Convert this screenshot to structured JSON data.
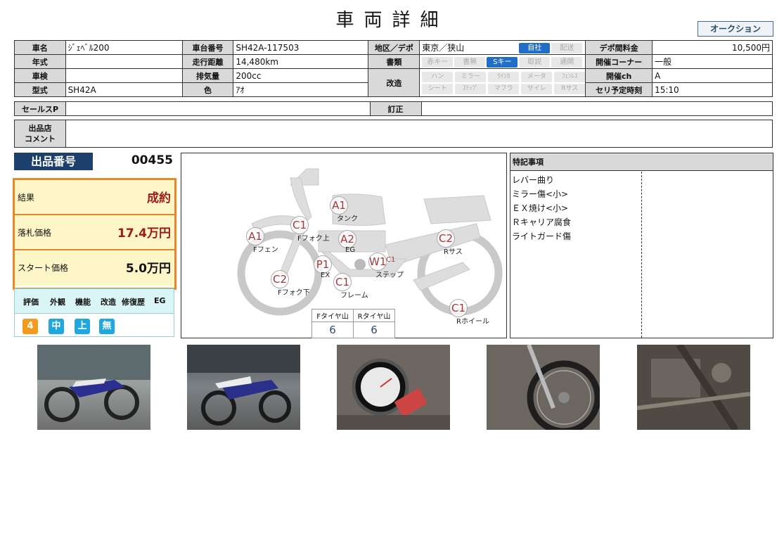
{
  "title": "車両詳細",
  "auction_button": "オークション",
  "info": {
    "row1": {
      "l1": "車名",
      "v1": "ｼﾞｪﾍﾞﾙ200",
      "l2": "車台番号",
      "v2": "SH42A-117503",
      "l3": "地区／デポ",
      "v3": "東京／狭山",
      "l4": "デポ間料金",
      "v4": "10,500円"
    },
    "row2": {
      "l1": "年式",
      "v1": "",
      "l2": "走行距離",
      "v2": "14,480km",
      "l3": "書類",
      "l4": "開催コーナー",
      "v4": "一般"
    },
    "row3": {
      "l1": "車検",
      "v1": "",
      "l2": "排気量",
      "v2": "200cc",
      "l3": "改造",
      "l4": "開催ch",
      "v4": "A"
    },
    "row4": {
      "l1": "型式",
      "v1": "SH42A",
      "l2": "色",
      "v2": "ｱｵ",
      "l4": "セリ予定時刻",
      "v4": "15:10"
    },
    "delivery": [
      {
        "label": "自社",
        "on": true
      },
      {
        "label": "配送",
        "on": false
      }
    ],
    "docs": [
      {
        "label": "赤キー",
        "on": false
      },
      {
        "label": "書無",
        "on": false
      },
      {
        "label": "Sキー",
        "on": true
      },
      {
        "label": "取説",
        "on": false
      },
      {
        "label": "通関",
        "on": false
      }
    ],
    "mods": [
      "ハン",
      "ミラー",
      "ｳｲﾝｶ",
      "メータ",
      "ﾌｪﾝﾚｽ",
      "シート",
      "ｽﾃｯﾌﾟ",
      "マフラ",
      "サイレ",
      "Rサス"
    ],
    "sales_label": "セールスP",
    "sales_value": "",
    "correction_label": "訂正",
    "correction_value": "",
    "comment_label": "出品店\nコメント",
    "comment_value": ""
  },
  "lot": {
    "label": "出品番号",
    "number": "00455"
  },
  "result": {
    "result_label": "結果",
    "result_value": "成約",
    "price_label": "落札価格",
    "price_value": "17.4万円",
    "start_label": "スタート価格",
    "start_value": "5.0万円",
    "colors": {
      "accent": "#e7892b",
      "bg": "#fff6c7",
      "red": "#9b1b1b"
    }
  },
  "evaluation": {
    "headers": [
      "評価",
      "外観",
      "機能",
      "改造",
      "修復歴",
      "EG"
    ],
    "values": [
      {
        "v": "4",
        "color": "#f29b1f"
      },
      {
        "v": "中",
        "color": "#1fa8e0"
      },
      {
        "v": "上",
        "color": "#1fa8e0"
      },
      {
        "v": "無",
        "color": "#1fa8e0"
      }
    ]
  },
  "diagram": {
    "marks": [
      {
        "code": "A1",
        "label": "タンク"
      },
      {
        "code": "C1",
        "label": "Fフォク上"
      },
      {
        "code": "A1",
        "label": "Fフェン"
      },
      {
        "code": "A2",
        "label": "EG"
      },
      {
        "code": "C2",
        "label": "Rサス"
      },
      {
        "code": "P1",
        "label": "EX"
      },
      {
        "code": "W1",
        "label": "ステップ",
        "sub": "C1"
      },
      {
        "code": "C2",
        "label": "Fフォク下"
      },
      {
        "code": "C1",
        "label": "フレーム"
      },
      {
        "code": "C1",
        "label": "Rホイール"
      }
    ],
    "tires": {
      "f_label": "Fタイヤ山",
      "r_label": "Rタイヤ山",
      "f_value": "6",
      "r_value": "6"
    }
  },
  "tokki": {
    "title": "特記事項",
    "items": [
      "レバー曲り",
      "ミラー傷<小>",
      "ＥＸ焼け<小>",
      "Ｒキャリア腐食",
      "ライトガード傷"
    ]
  },
  "photos": [
    "bike-left-side",
    "bike-right-side",
    "meter-closeup",
    "front-wheel",
    "engine-frame"
  ]
}
